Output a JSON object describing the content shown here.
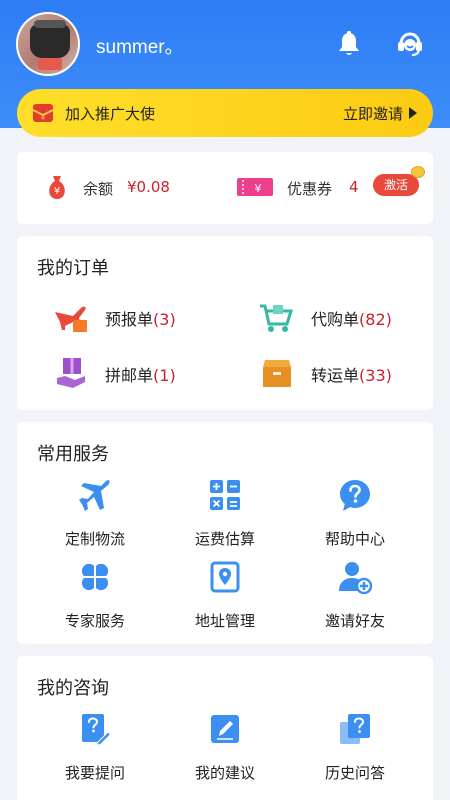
{
  "profile": {
    "username": "summer。"
  },
  "header_icons": {
    "notification": "bell-icon",
    "support": "customer-service-icon"
  },
  "promo": {
    "text": "加入推广大使",
    "link_text": "立即邀请"
  },
  "balance": {
    "label": "余额",
    "value": "¥0.08",
    "coupon_label": "优惠券",
    "coupon_value": "4",
    "activate_label": "激活"
  },
  "orders": {
    "title": "我的订单",
    "items": [
      {
        "label": "预报单",
        "count": "(3)",
        "icon": "airplane-box-icon"
      },
      {
        "label": "代购单",
        "count": "(82)",
        "icon": "shopping-cart-icon"
      },
      {
        "label": "拼邮单",
        "count": "(1)",
        "icon": "hand-box-icon"
      },
      {
        "label": "转运单",
        "count": "(33)",
        "icon": "package-box-icon"
      }
    ]
  },
  "services": {
    "title": "常用服务",
    "items": [
      {
        "label": "定制物流",
        "icon": "airplane-icon"
      },
      {
        "label": "运费估算",
        "icon": "calculator-icon"
      },
      {
        "label": "帮助中心",
        "icon": "question-icon"
      },
      {
        "label": "专家服务",
        "icon": "clover-icon"
      },
      {
        "label": "地址管理",
        "icon": "location-icon"
      },
      {
        "label": "邀请好友",
        "icon": "add-user-icon"
      }
    ]
  },
  "consult": {
    "title": "我的咨询",
    "items": [
      {
        "label": "我要提问",
        "icon": "ask-question-icon"
      },
      {
        "label": "我的建议",
        "icon": "edit-note-icon"
      },
      {
        "label": "历史问答",
        "icon": "history-question-icon"
      }
    ]
  },
  "colors": {
    "primary": "#2e7cf6",
    "accent_red": "#c8232c",
    "promo_yellow": "#fcd21a",
    "icon_blue": "#3b8ff0"
  }
}
